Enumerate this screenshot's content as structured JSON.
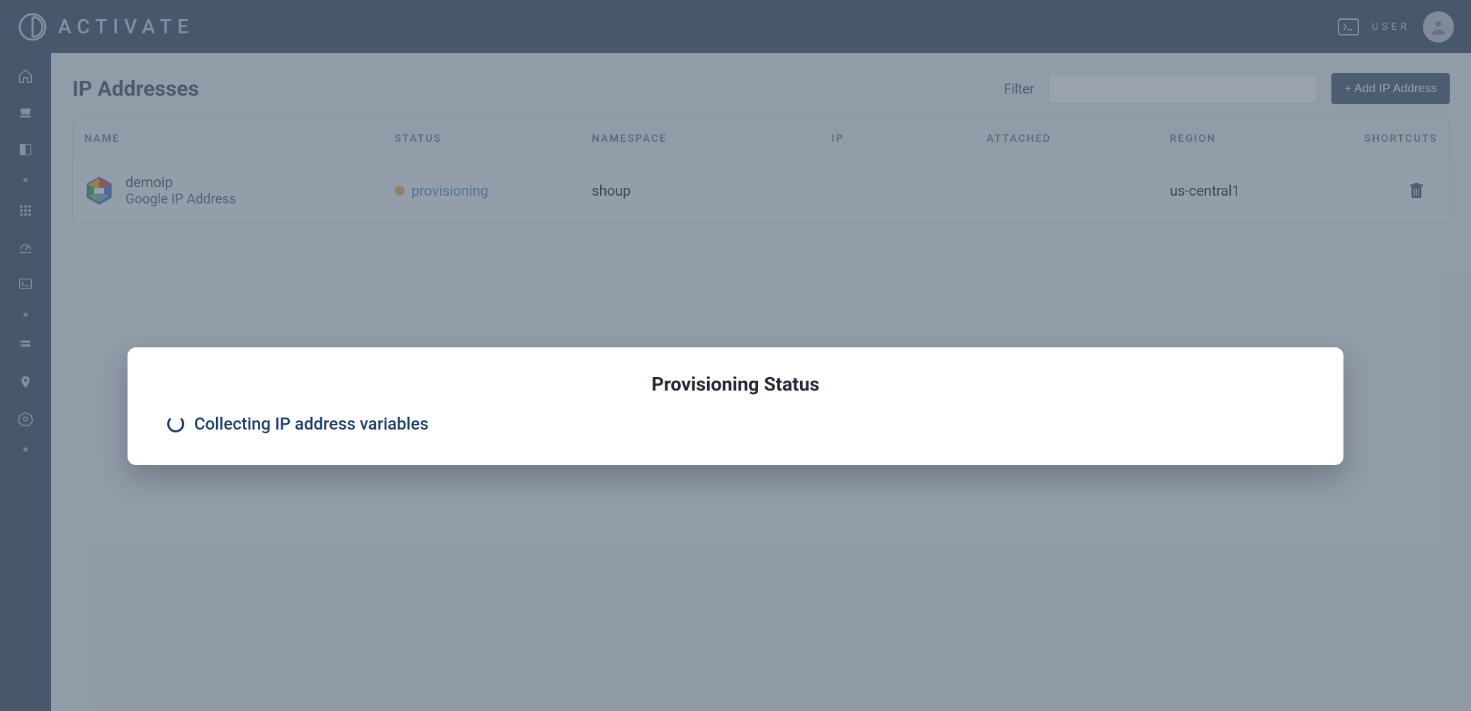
{
  "brand": {
    "name": "ACTIVATE"
  },
  "header": {
    "user_label": "USER"
  },
  "page": {
    "title": "IP Addresses",
    "filter_label": "Filter",
    "filter_value": "",
    "add_button": "+ Add IP Address"
  },
  "table": {
    "columns": {
      "name": "NAME",
      "status": "STATUS",
      "namespace": "NAMESPACE",
      "ip": "IP",
      "attached": "ATTACHED",
      "region": "REGION",
      "shortcuts": "SHORTCUTS"
    },
    "rows": [
      {
        "name": "demoip",
        "subtitle": "Google IP Address",
        "status": "provisioning",
        "namespace": "shoup",
        "ip": "",
        "attached": "",
        "region": "us-central1"
      }
    ]
  },
  "modal": {
    "title": "Provisioning Status",
    "message": "Collecting IP address variables"
  }
}
